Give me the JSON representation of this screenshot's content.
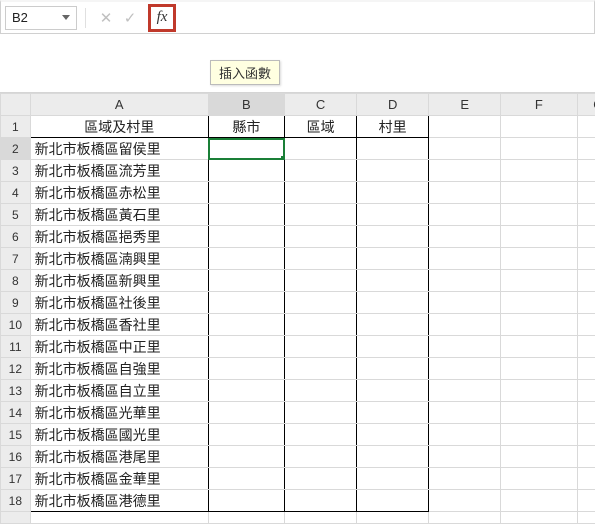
{
  "formula_bar": {
    "name_box_value": "B2",
    "cancel_glyph": "✕",
    "confirm_glyph": "✓",
    "fx_label": "fx",
    "formula_value": "",
    "tooltip": "插入函數"
  },
  "columns": [
    "A",
    "B",
    "C",
    "D",
    "E",
    "F",
    "G"
  ],
  "headers": {
    "A": "區域及村里",
    "B": "縣市",
    "C": "區域",
    "D": "村里"
  },
  "rows": [
    "新北市板橋區留侯里",
    "新北市板橋區流芳里",
    "新北市板橋區赤松里",
    "新北市板橋區黃石里",
    "新北市板橋區挹秀里",
    "新北市板橋區湳興里",
    "新北市板橋區新興里",
    "新北市板橋區社後里",
    "新北市板橋區香社里",
    "新北市板橋區中正里",
    "新北市板橋區自強里",
    "新北市板橋區自立里",
    "新北市板橋區光華里",
    "新北市板橋區國光里",
    "新北市板橋區港尾里",
    "新北市板橋區金華里",
    "新北市板橋區港德里"
  ],
  "selected": {
    "col": "B",
    "row": 2
  }
}
